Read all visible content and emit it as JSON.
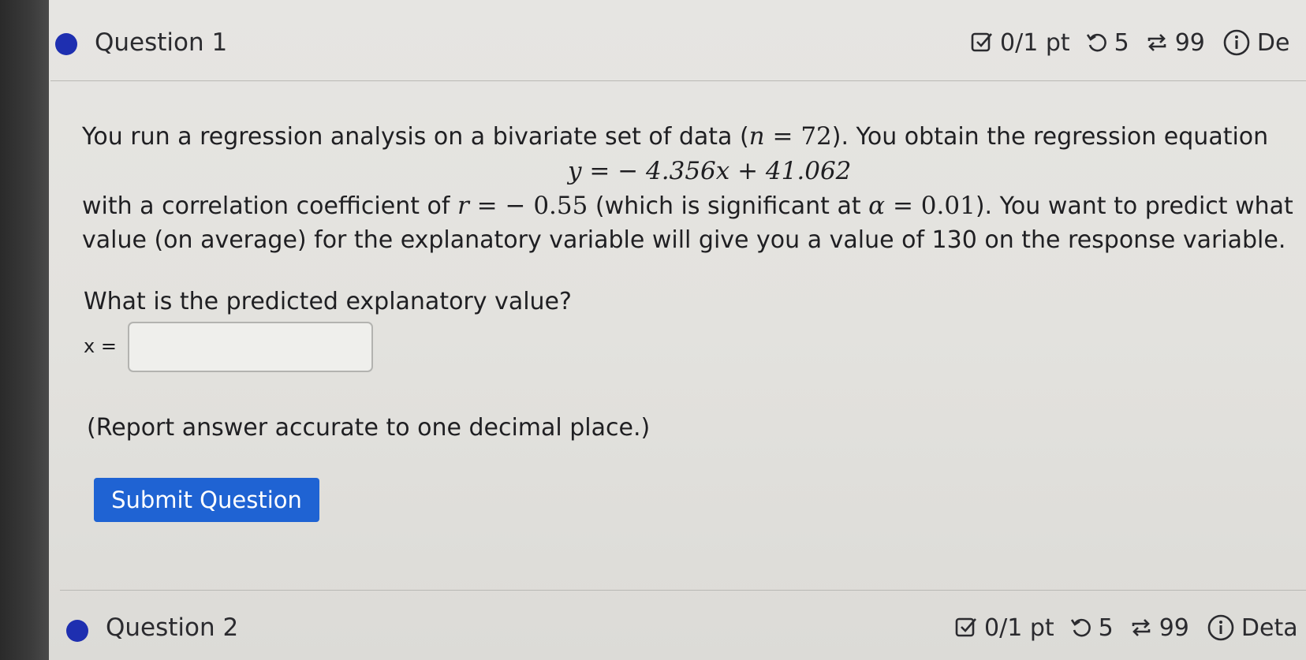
{
  "questions": [
    {
      "title": "Question 1",
      "points": "0/1 pt",
      "attempts": "5",
      "versions": "99",
      "details_label": "De"
    },
    {
      "title": "Question 2",
      "points": "0/1 pt",
      "attempts": "5",
      "versions": "99",
      "details_label": "Deta"
    }
  ],
  "problem": {
    "line1_text": "You run a regression analysis on a bivariate set of data (",
    "n_var": "n",
    "n_value": "= 72",
    "line1_after": "). You obtain the regression equation",
    "equation": "y =  − 4.356x + 41.062",
    "line3_text": "with a correlation coefficient of ",
    "r_var": "r",
    "r_value": " =  − 0.55",
    "line3_mid": " (which is significant at ",
    "alpha_var": "α",
    "alpha_value": " = 0.01",
    "line3_after": "). You want to predict what",
    "line4": "value (on average) for the explanatory variable will give you a value of 130 on the response variable.",
    "question": "What is the predicted explanatory value?",
    "answer_label": "x =",
    "answer_value": "",
    "answer_placeholder": "",
    "note": "(Report answer accurate to one decimal place.)",
    "submit_label": "Submit Question"
  },
  "colors": {
    "accent_dot": "#1e2fb0",
    "submit_button": "#1f63d3",
    "page_bg": "#e4e3e0"
  }
}
